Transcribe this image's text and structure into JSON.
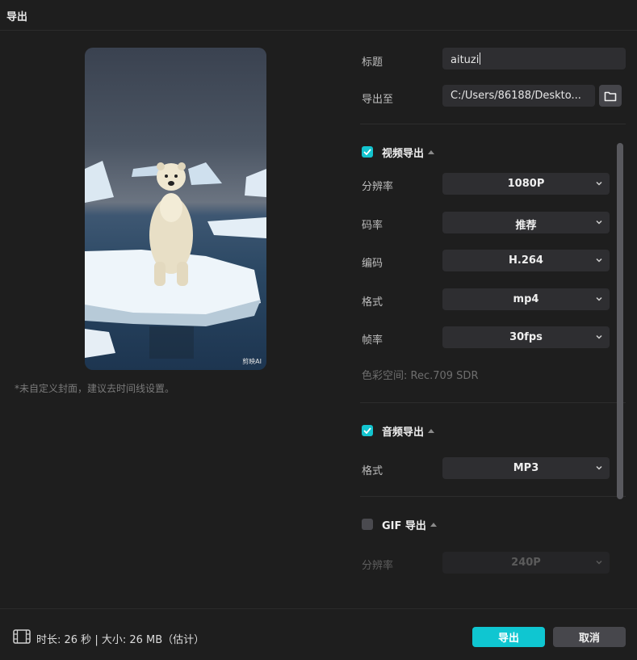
{
  "window": {
    "title": "导出"
  },
  "preview": {
    "watermark": "剪映AI",
    "note": "*未自定义封面，建议去时间线设置。"
  },
  "form": {
    "title_label": "标题",
    "title_value": "aituzi",
    "export_to_label": "导出至",
    "export_to_value": "C:/Users/86188/Deskto..."
  },
  "video": {
    "section_title": "视频导出",
    "checked": true,
    "resolution_label": "分辨率",
    "resolution_value": "1080P",
    "bitrate_label": "码率",
    "bitrate_value": "推荐",
    "codec_label": "编码",
    "codec_value": "H.264",
    "format_label": "格式",
    "format_value": "mp4",
    "framerate_label": "帧率",
    "framerate_value": "30fps",
    "colorspace_text": "色彩空间:  Rec.709 SDR"
  },
  "audio": {
    "section_title": "音频导出",
    "checked": true,
    "format_label": "格式",
    "format_value": "MP3"
  },
  "gif": {
    "section_title": "GIF 导出",
    "checked": false,
    "resolution_label": "分辨率",
    "resolution_value": "240P"
  },
  "footer": {
    "info": "时长:  26 秒 | 大小:  26 MB（估计）",
    "export_button": "导出",
    "cancel_button": "取消"
  },
  "colors": {
    "accent": "#0fc6d1",
    "background": "#1e1e1e",
    "field": "#2e2e31"
  },
  "icons": [
    "folder-icon",
    "check-icon",
    "chevron-up-icon",
    "chevron-down-icon",
    "film-icon"
  ]
}
